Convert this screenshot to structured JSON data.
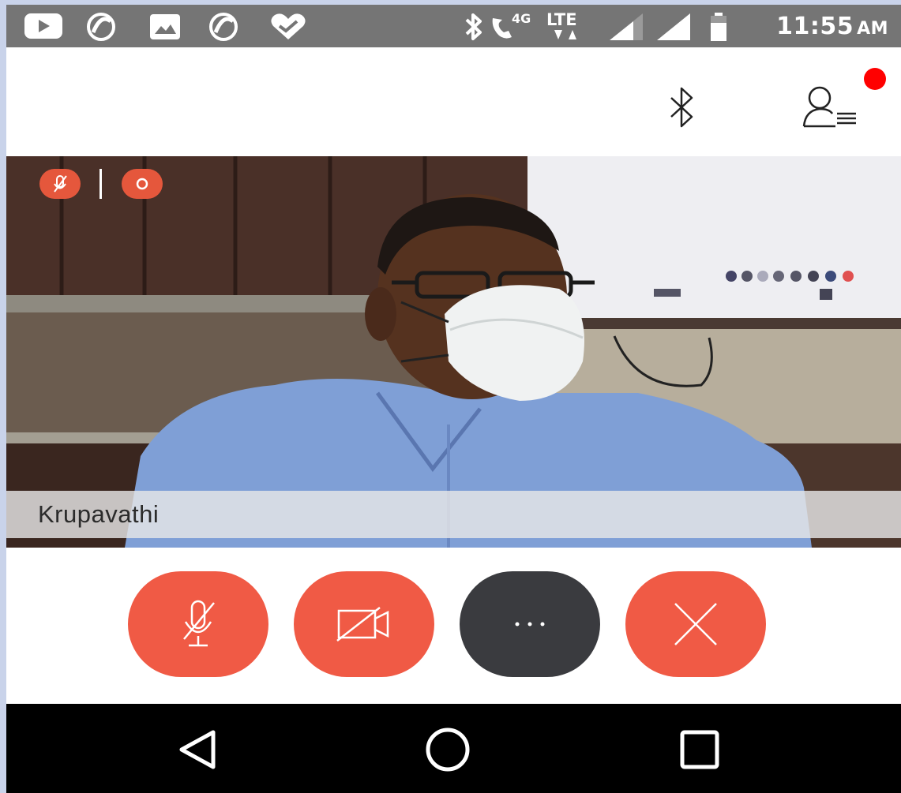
{
  "status_bar": {
    "time": "11:55",
    "ampm": "AM",
    "network_4g": "4G",
    "network_lte": "LTE",
    "icons": [
      "youtube-icon",
      "sync-icon",
      "gallery-icon",
      "sync-icon",
      "heart-icon",
      "bluetooth-icon",
      "wifi-calling-icon",
      "signal-icon",
      "signal-icon",
      "battery-icon"
    ]
  },
  "header": {
    "icons": [
      "bluetooth-icon",
      "participants-icon"
    ],
    "notification_color": "#ff0000"
  },
  "video": {
    "participant_name": "Krupavathi",
    "indicators": [
      "mic-muted-icon",
      "recording-icon"
    ]
  },
  "controls": [
    {
      "name": "mute-mic-button",
      "icon": "mic-off-icon",
      "color": "#f05a45"
    },
    {
      "name": "camera-off-button",
      "icon": "video-off-icon",
      "color": "#f05a45"
    },
    {
      "name": "more-options-button",
      "icon": "more-icon",
      "color": "#3a3b3f"
    },
    {
      "name": "end-call-button",
      "icon": "close-icon",
      "color": "#f05a45"
    }
  ],
  "nav_bar": {
    "icons": [
      "back-icon",
      "home-icon",
      "recents-icon"
    ]
  }
}
